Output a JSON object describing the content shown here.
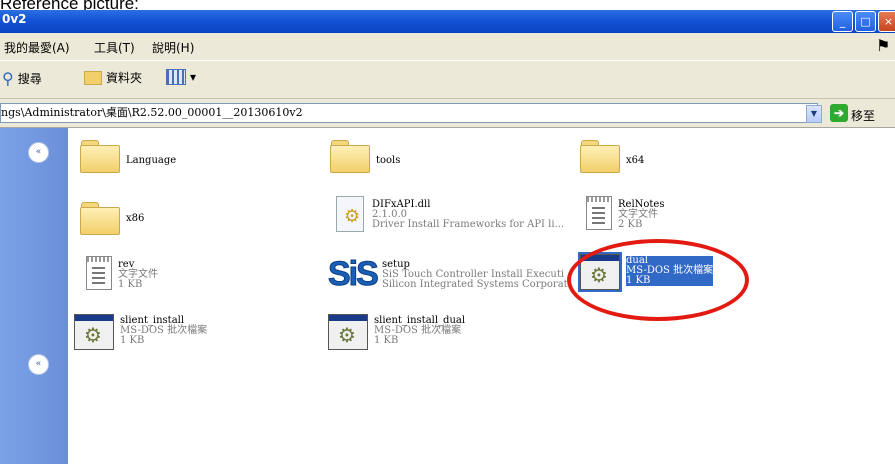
{
  "caption": "Reference picture:",
  "window": {
    "title": "0v2"
  },
  "menu": {
    "favorites": "我的最愛(A)",
    "tools": "工具(T)",
    "help": "說明(H)"
  },
  "toolbar": {
    "search": "搜尋",
    "folders": "資料夾",
    "views_arrow": "▾"
  },
  "address": {
    "path": "ngs\\Administrator\\桌面\\R2.52.00_00001__20130610v2",
    "go_label": "移至"
  },
  "leftpane": {
    "collapse1": "«",
    "collapse2": "«"
  },
  "items": [
    {
      "name": "Language"
    },
    {
      "name": "tools"
    },
    {
      "name": "x64"
    },
    {
      "name": "x86"
    },
    {
      "name": "DIFxAPI.dll",
      "line1": "2.1.0.0",
      "line2": "Driver Install Frameworks for API li..."
    },
    {
      "name": "RelNotes",
      "line1": "文字文件",
      "line2": "2 KB"
    },
    {
      "name": "rev",
      "line1": "文字文件",
      "line2": "1 KB"
    },
    {
      "name": "setup",
      "line1": "SiS Touch Controller Install Executi",
      "line2": "Silicon Integrated Systems Corporat"
    },
    {
      "name": "dual",
      "line1": "MS-DOS 批次檔案",
      "line2": "1 KB"
    },
    {
      "name": "slient_install",
      "line1": "MS-DOS 批次檔案",
      "line2": "1 KB"
    },
    {
      "name": "slient_install_dual",
      "line1": "MS-DOS 批次檔案",
      "line2": "1 KB"
    }
  ],
  "colors": {
    "selection": "#3169c6",
    "highlight_ring": "#e21a12",
    "titlebar": "#1553d6",
    "leftpane": "#7ba2e7"
  }
}
